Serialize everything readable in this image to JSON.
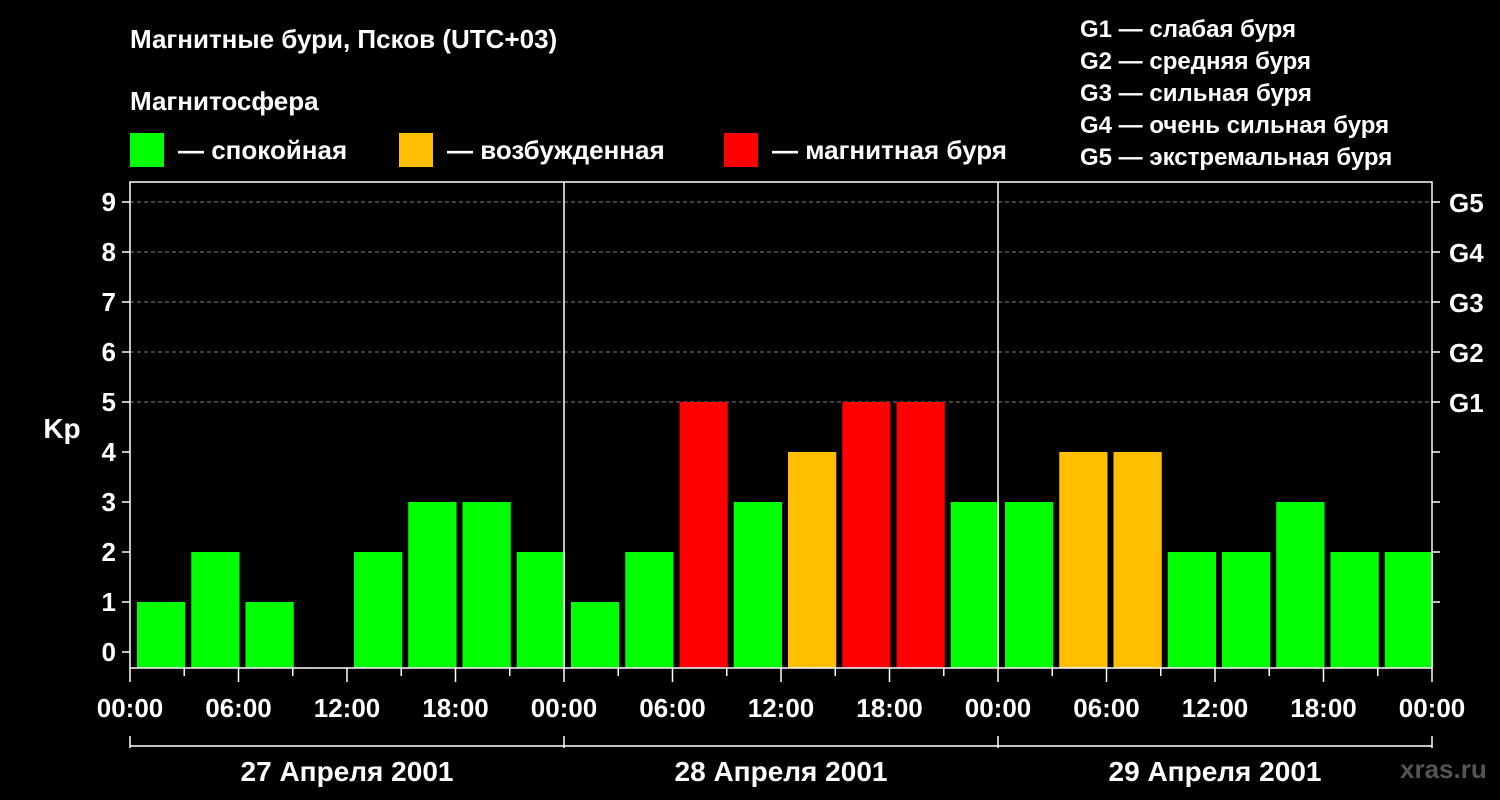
{
  "title": "Магнитные бури, Псков (UTC+03)",
  "legend": {
    "heading": "Магнитосфера",
    "items": [
      {
        "label": "— спокойная",
        "color": "#00ff00"
      },
      {
        "label": "— возбужденная",
        "color": "#ffbf00"
      },
      {
        "label": "— магнитная буря",
        "color": "#ff0000"
      }
    ]
  },
  "g_scale": [
    "G1 — слабая буря",
    "G2 — средняя буря",
    "G3 — сильная буря",
    "G4 — очень сильная буря",
    "G5 — экстремальная буря"
  ],
  "watermark": "xras.ru",
  "chart_data": {
    "type": "bar",
    "ylabel": "Kp",
    "ylim": [
      0,
      9
    ],
    "y_ticks": [
      0,
      1,
      2,
      3,
      4,
      5,
      6,
      7,
      8,
      9
    ],
    "right_axis_labels": [
      {
        "value": 5,
        "label": "G1"
      },
      {
        "value": 6,
        "label": "G2"
      },
      {
        "value": 7,
        "label": "G3"
      },
      {
        "value": 8,
        "label": "G4"
      },
      {
        "value": 9,
        "label": "G5"
      }
    ],
    "x_tick_labels": [
      "00:00",
      "06:00",
      "12:00",
      "18:00",
      "00:00",
      "06:00",
      "12:00",
      "18:00",
      "00:00",
      "06:00",
      "12:00",
      "18:00",
      "00:00"
    ],
    "days": [
      "27 Апреля 2001",
      "28 Апреля 2001",
      "29 Апреля 2001"
    ],
    "grid": "horizontal dashed at 5–9",
    "bar_interval_hours": 3,
    "values": [
      1,
      2,
      1,
      0,
      2,
      3,
      3,
      2,
      1,
      2,
      5,
      3,
      4,
      5,
      5,
      3,
      3,
      4,
      4,
      2,
      2,
      3,
      2,
      2
    ],
    "colors": {
      "quiet": "#00ff00",
      "active": "#ffbf00",
      "storm": "#ff0000"
    },
    "thresholds": {
      "active_min": 4,
      "storm_min": 5
    }
  }
}
